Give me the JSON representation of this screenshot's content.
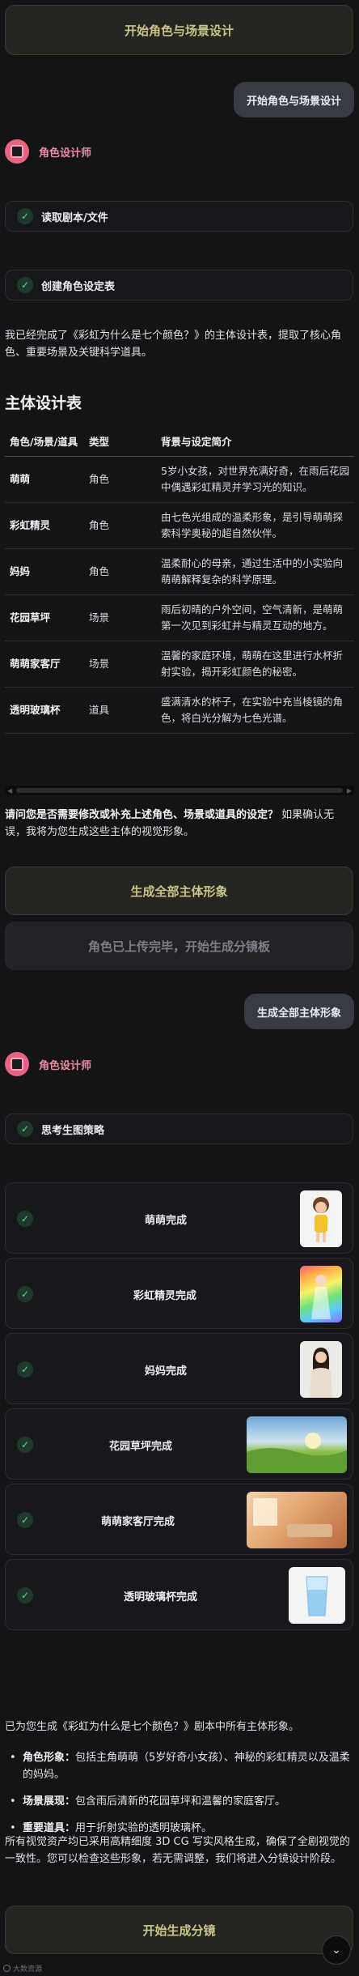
{
  "top_button": "开始角色与场景设计",
  "user_msg_1": "开始角色与场景设计",
  "agent_name": "角色设计师",
  "tasks_1": [
    "读取剧本/文件",
    "创建角色设定表"
  ],
  "intro": "我已经完成了《彩虹为什么是七个颜色？》的主体设计表，提取了核心角色、重要场景及关键科学道具。",
  "table_heading": "主体设计表",
  "table": {
    "headers": [
      "角色/场景/道具",
      "类型",
      "背景与设定简介"
    ],
    "rows": [
      [
        "萌萌",
        "角色",
        "5岁小女孩，对世界充满好奇，在雨后花园中偶遇彩虹精灵并学习光的知识。"
      ],
      [
        "彩虹精灵",
        "角色",
        "由七色光组成的温柔形象，是引导萌萌探索科学奥秘的超自然伙伴。"
      ],
      [
        "妈妈",
        "角色",
        "温柔耐心的母亲，通过生活中的小实验向萌萌解释复杂的科学原理。"
      ],
      [
        "花园草坪",
        "场景",
        "雨后初晴的户外空间，空气清新，是萌萌第一次见到彩虹并与精灵互动的地方。"
      ],
      [
        "萌萌家客厅",
        "场景",
        "温馨的家庭环境，萌萌在这里进行水杯折射实验，揭开彩虹颜色的秘密。"
      ],
      [
        "透明玻璃杯",
        "道具",
        "盛满清水的杯子，在实验中充当棱镜的角色，将白光分解为七色光谱。"
      ]
    ]
  },
  "question_bold": "请问您是否需要修改或补充上述角色、场景或道具的设定？",
  "question_rest": " 如果确认无误，我将为您生成这些主体的视觉形象。",
  "gen_all_button": "生成全部主体形象",
  "uploaded_button": "角色已上传完毕，开始生成分镜板",
  "user_msg_2": "生成全部主体形象",
  "task_strategy": "思考生图策略",
  "results": [
    "萌萌完成",
    "彩虹精灵完成",
    "妈妈完成",
    "花园草坪完成",
    "萌萌家客厅完成",
    "透明玻璃杯完成"
  ],
  "summary": "已为您生成《彩虹为什么是七个颜色？》剧本中所有主体形象。",
  "bullets": [
    {
      "label": "角色形象：",
      "text": "包括主角萌萌（5岁好奇小女孩）、神秘的彩虹精灵以及温柔的妈妈。"
    },
    {
      "label": "场景展现：",
      "text": "包含雨后清新的花园草坪和温馨的家庭客厅。"
    },
    {
      "label": "重要道具：",
      "text": "用于折射实验的透明玻璃杯。"
    }
  ],
  "closing": "所有视觉资产均已采用高精细度 3D CG 写实风格生成，确保了全剧视觉的一致性。您可以检查这些形象，若无需调整，我们将进入分镜设计阶段。",
  "storyboard_button": "开始生成分镜",
  "watermark": "大数资源",
  "colors": {
    "accent_pink": "#f08aa0",
    "check_green": "#5ed48e",
    "olive_text": "#c9c48a"
  }
}
